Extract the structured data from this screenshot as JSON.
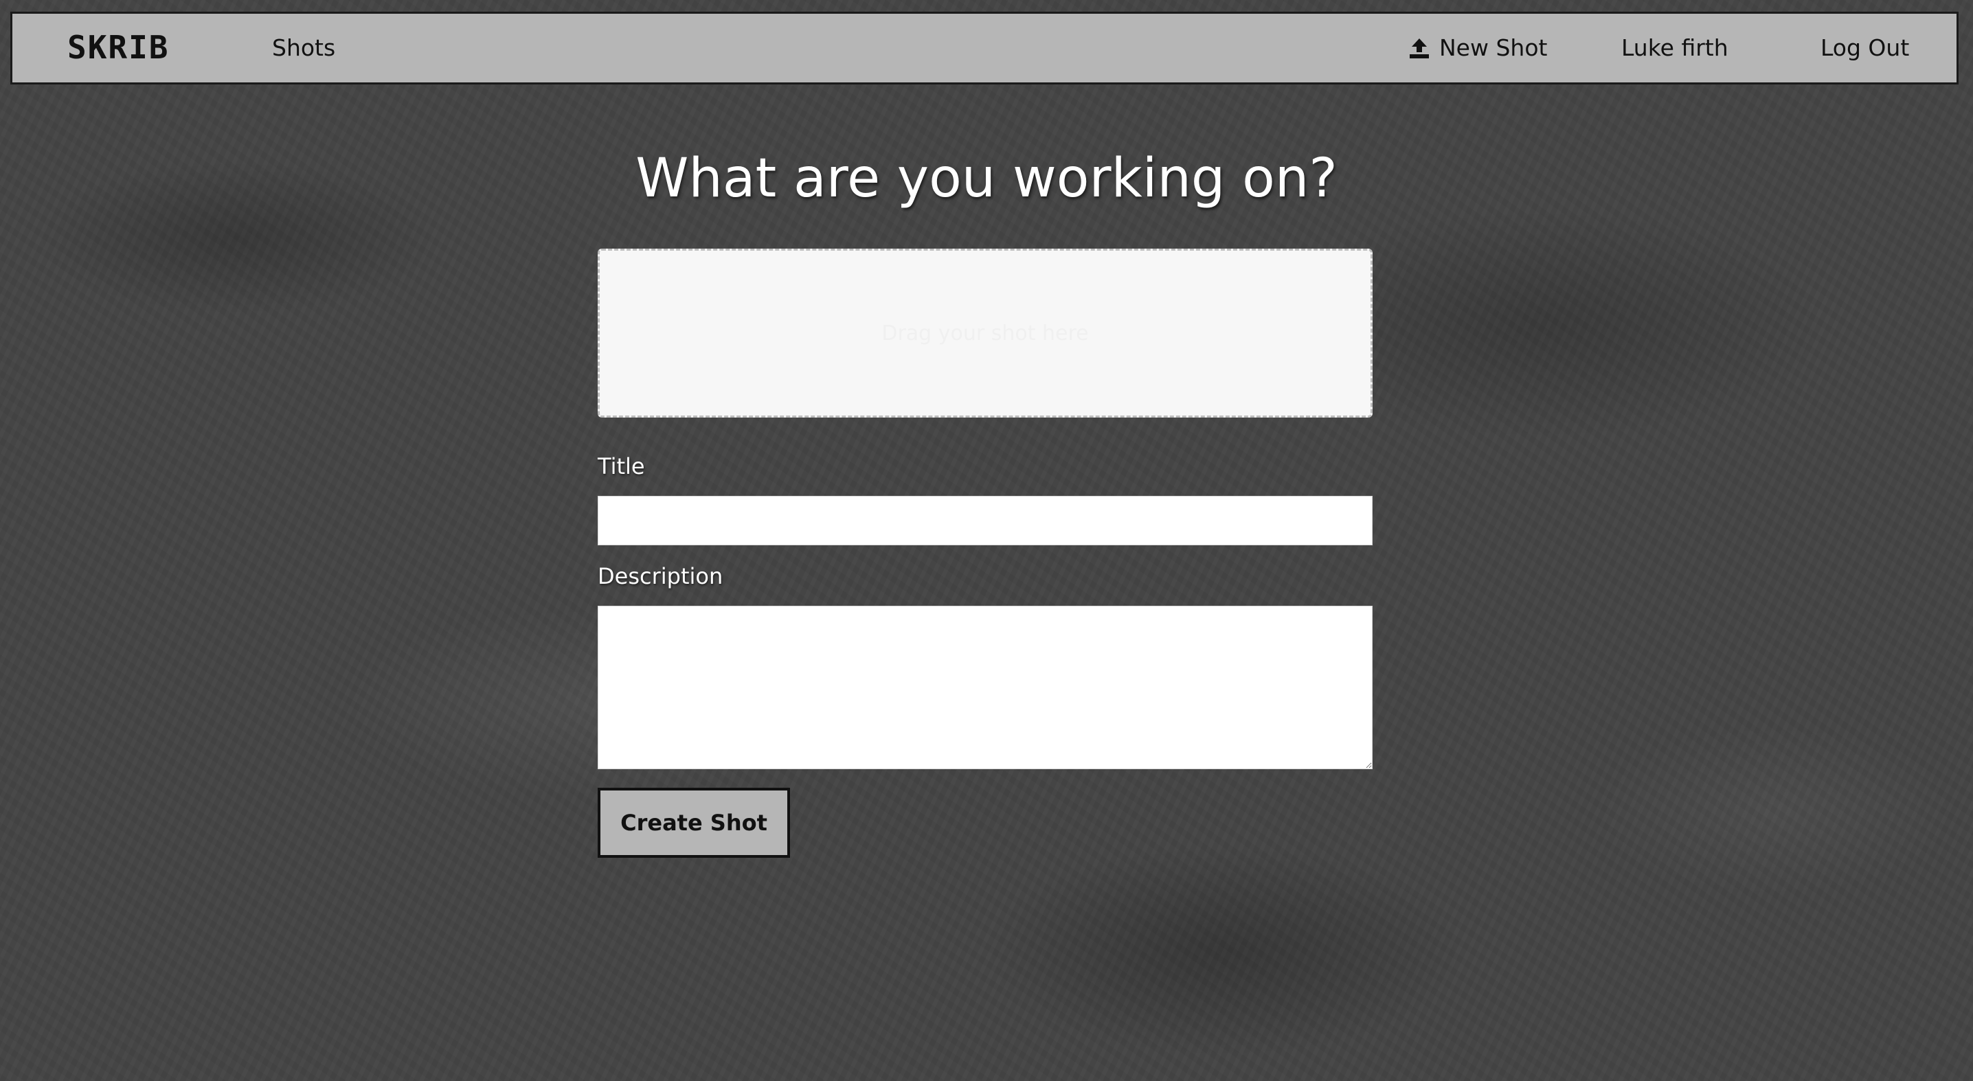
{
  "nav": {
    "logo": "SKRIB",
    "shots": "Shots",
    "new_shot": "New Shot",
    "user": "Luke firth",
    "logout": "Log Out"
  },
  "form": {
    "heading": "What are you working on?",
    "dropzone_text": "Drag your shot here",
    "title_label": "Title",
    "title_value": "",
    "description_label": "Description",
    "description_value": "",
    "submit_label": "Create Shot"
  }
}
